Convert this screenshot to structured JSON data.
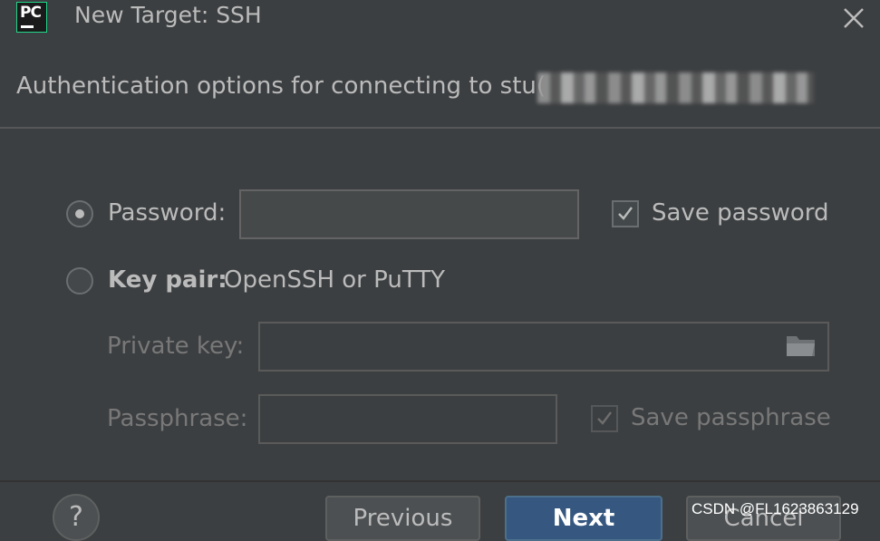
{
  "window": {
    "app_icon": "pycharm-icon",
    "app_icon_text": "PC",
    "title": "New Target: SSH",
    "close_icon": "close-icon"
  },
  "header": {
    "subtitle": "Authentication options for connecting to stu("
  },
  "auth": {
    "password_option": {
      "label": "Password:",
      "selected": true,
      "value": ""
    },
    "save_password": {
      "label": "Save password",
      "checked": true
    },
    "keypair_option": {
      "label": "Key pair:",
      "hint": "OpenSSH or PuTTY",
      "selected": false
    },
    "private_key": {
      "label": "Private key:",
      "value": "",
      "browse_icon": "folder-icon"
    },
    "passphrase": {
      "label": "Passphrase:",
      "value": ""
    },
    "save_passphrase": {
      "label": "Save passphrase",
      "checked": true
    }
  },
  "footer": {
    "help_label": "?",
    "previous_label": "Previous",
    "next_label": "Next",
    "cancel_label": "Cancel"
  },
  "watermark": "CSDN @FL1623863129",
  "colors": {
    "background": "#3c3f41",
    "text": "#bbbbbb",
    "primary_button": "#365880",
    "logo_accent": "#21d789"
  }
}
